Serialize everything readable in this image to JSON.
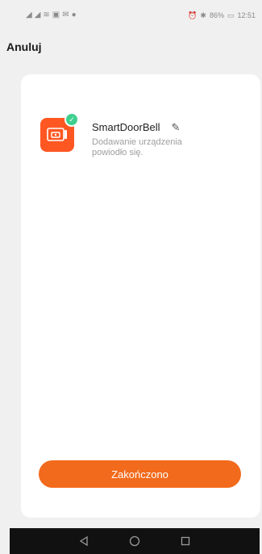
{
  "status_bar": {
    "left_icons": [
      "signal-icon",
      "signal-icon",
      "wifi-icon",
      "sim-icon",
      "mail-icon",
      "circle-icon"
    ],
    "battery": "86%",
    "time": "12:51"
  },
  "header": {
    "cancel_label": "Anuluj"
  },
  "device": {
    "name": "SmartDoorBell",
    "status": "Dodawanie urządzenia powiodło się.",
    "icon": "doorbell-icon",
    "badge": "check-icon"
  },
  "footer": {
    "finish_label": "Zakończono"
  },
  "colors": {
    "accent": "#f26a1b",
    "device_icon_bg": "#ff5722",
    "badge": "#3ecf8e",
    "background": "#f0f0f0",
    "card": "#ffffff"
  },
  "nav_bar": {
    "buttons": [
      "back-icon",
      "home-icon",
      "recents-icon"
    ]
  }
}
